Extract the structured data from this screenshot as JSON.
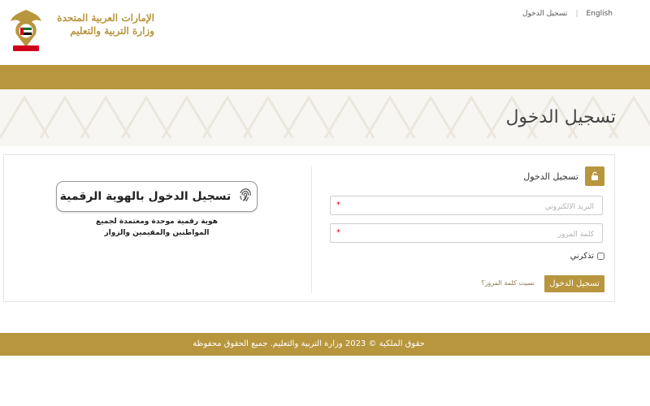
{
  "header": {
    "org_line1": "الإمارات العربية المتحدة",
    "org_line2": "وزارة التربية والتعليم",
    "emblem_icon": "uae-emblem-icon",
    "top_links": {
      "english": "English",
      "login": "تسجيل الدخول"
    }
  },
  "page": {
    "title": "تسجيل الدخول"
  },
  "form": {
    "title": "تسجيل الدخول",
    "email_placeholder": "البريد الالكتروني",
    "password_placeholder": "كلمة المرور",
    "required_mark": "*",
    "remember_label": "تذكرني",
    "login_button": "تسجيل الدخول",
    "forgot_link": "نسيت كلمة المرور؟"
  },
  "uaepass": {
    "button_label": "تسجيل الدخول بالهوية الرقمية",
    "description_line1": "هوية رقمية موحدة ومعتمدة لجميع",
    "description_line2": "المواطنين والمقيمين والزوار"
  },
  "footer": {
    "copyright": "حقوق الملكية © 2023 وزارة التربية والتعليم. جميع الحقوق محفوظة"
  },
  "colors": {
    "accent_gold": "#b8963e",
    "background": "#ffffff",
    "pattern_bg": "#f7f6f3"
  }
}
